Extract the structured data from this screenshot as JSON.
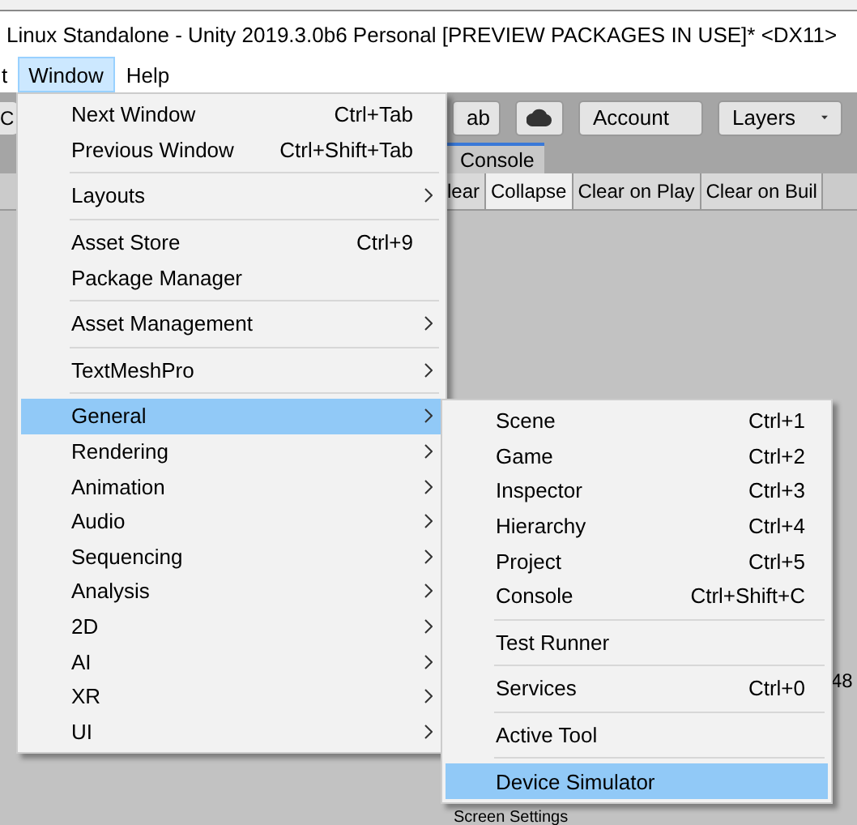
{
  "window": {
    "title": "Linux Standalone - Unity 2019.3.0b6 Personal [PREVIEW PACKAGES IN USE]* <DX11>"
  },
  "menu_bar": [
    {
      "label": "t",
      "selected": false
    },
    {
      "label": "Window",
      "selected": true
    },
    {
      "label": "Help",
      "selected": false
    }
  ],
  "toolbar": {
    "left_fragment": "C",
    "buttons": [
      {
        "kind": "dropdown",
        "label": "ab"
      },
      {
        "kind": "cloud"
      },
      {
        "kind": "dropdown",
        "label": "Account"
      },
      {
        "kind": "dropdown",
        "label": "Layers"
      }
    ]
  },
  "console": {
    "tab": "Console",
    "buttons": [
      {
        "label": "lear",
        "on": false
      },
      {
        "label": "Collapse",
        "on": true
      },
      {
        "label": "Clear on Play",
        "on": false
      },
      {
        "label": "Clear on Buil",
        "on": false
      }
    ],
    "value_fragment": "48",
    "section": "Screen Settings"
  },
  "window_menu": {
    "groups": [
      {
        "items": [
          {
            "label": "Next Window",
            "shortcut": "Ctrl+Tab",
            "submenu": false,
            "selected": false
          },
          {
            "label": "Previous Window",
            "shortcut": "Ctrl+Shift+Tab",
            "submenu": false,
            "selected": false
          }
        ]
      },
      {
        "items": [
          {
            "label": "Layouts",
            "submenu": true,
            "selected": false
          }
        ]
      },
      {
        "items": [
          {
            "label": "Asset Store",
            "shortcut": "Ctrl+9",
            "submenu": false,
            "selected": false
          },
          {
            "label": "Package Manager",
            "submenu": false,
            "selected": false
          }
        ]
      },
      {
        "items": [
          {
            "label": "Asset Management",
            "submenu": true,
            "selected": false
          }
        ]
      },
      {
        "items": [
          {
            "label": "TextMeshPro",
            "submenu": true,
            "selected": false
          }
        ]
      },
      {
        "items": [
          {
            "label": "General",
            "submenu": true,
            "selected": true
          },
          {
            "label": "Rendering",
            "submenu": true,
            "selected": false
          },
          {
            "label": "Animation",
            "submenu": true,
            "selected": false
          },
          {
            "label": "Audio",
            "submenu": true,
            "selected": false
          },
          {
            "label": "Sequencing",
            "submenu": true,
            "selected": false
          },
          {
            "label": "Analysis",
            "submenu": true,
            "selected": false
          },
          {
            "label": "2D",
            "submenu": true,
            "selected": false
          },
          {
            "label": "AI",
            "submenu": true,
            "selected": false
          },
          {
            "label": "XR",
            "submenu": true,
            "selected": false
          },
          {
            "label": "UI",
            "submenu": true,
            "selected": false
          }
        ]
      }
    ]
  },
  "general_submenu": {
    "groups": [
      {
        "items": [
          {
            "label": "Scene",
            "shortcut": "Ctrl+1",
            "submenu": false,
            "selected": false
          },
          {
            "label": "Game",
            "shortcut": "Ctrl+2",
            "submenu": false,
            "selected": false
          },
          {
            "label": "Inspector",
            "shortcut": "Ctrl+3",
            "submenu": false,
            "selected": false
          },
          {
            "label": "Hierarchy",
            "shortcut": "Ctrl+4",
            "submenu": false,
            "selected": false
          },
          {
            "label": "Project",
            "shortcut": "Ctrl+5",
            "submenu": false,
            "selected": false
          },
          {
            "label": "Console",
            "shortcut": "Ctrl+Shift+C",
            "submenu": false,
            "selected": false
          }
        ]
      },
      {
        "items": [
          {
            "label": "Test Runner",
            "submenu": false,
            "selected": false
          }
        ]
      },
      {
        "items": [
          {
            "label": "Services",
            "shortcut": "Ctrl+0",
            "submenu": false,
            "selected": false
          }
        ]
      },
      {
        "items": [
          {
            "label": "Active Tool",
            "submenu": false,
            "selected": false
          }
        ]
      },
      {
        "items": [
          {
            "label": "Device Simulator",
            "submenu": false,
            "selected": true
          }
        ]
      }
    ]
  }
}
